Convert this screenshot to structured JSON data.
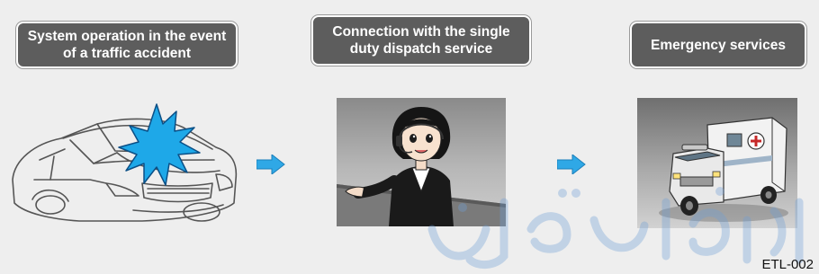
{
  "steps": [
    {
      "label": "System operation in the event of a traffic accident"
    },
    {
      "label": "Connection with the single duty dispatch service"
    },
    {
      "label": "Emergency services"
    }
  ],
  "reference_code": "ETL-002",
  "colors": {
    "label_background": "#5d5d5d",
    "label_text": "#ffffff",
    "arrow": "#2fa8e6",
    "impact_burst": "#1ea8e8",
    "watermark": "#6f9fd6"
  },
  "icons": [
    "car-outline-icon",
    "impact-burst-icon",
    "arrow-right-icon",
    "operator-icon",
    "ambulance-icon"
  ]
}
